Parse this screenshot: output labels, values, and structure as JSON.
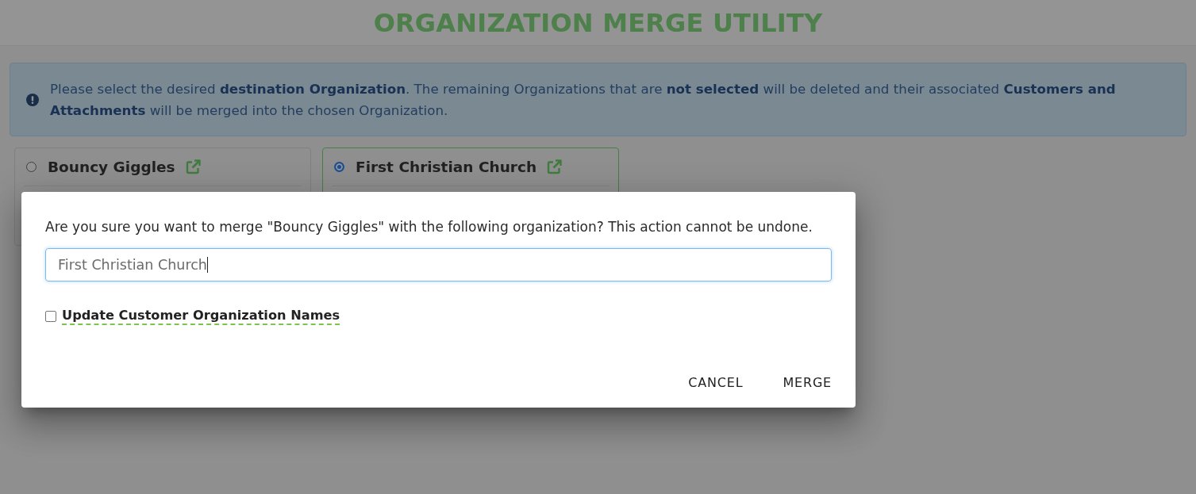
{
  "header": {
    "title": "ORGANIZATION MERGE UTILITY"
  },
  "alert": {
    "text": "Please select the desired **destination Organization**. The remaining Organizations that are **not selected** will be deleted and their associated **Customers and Attachments** will be merged into the chosen Organization."
  },
  "organizations": [
    {
      "name": "Bouncy Giggles",
      "selected": false
    },
    {
      "name": "First Christian Church",
      "selected": true
    }
  ],
  "dialog": {
    "message": "Are you sure you want to merge \"Bouncy Giggles\" with the following organization? This action cannot be undone.",
    "input": {
      "value": "First Christian Church",
      "focused": true
    },
    "checkbox": {
      "label": "Update Customer Organization Names",
      "checked": false
    },
    "buttons": [
      "CANCEL",
      "MERGE"
    ]
  }
}
